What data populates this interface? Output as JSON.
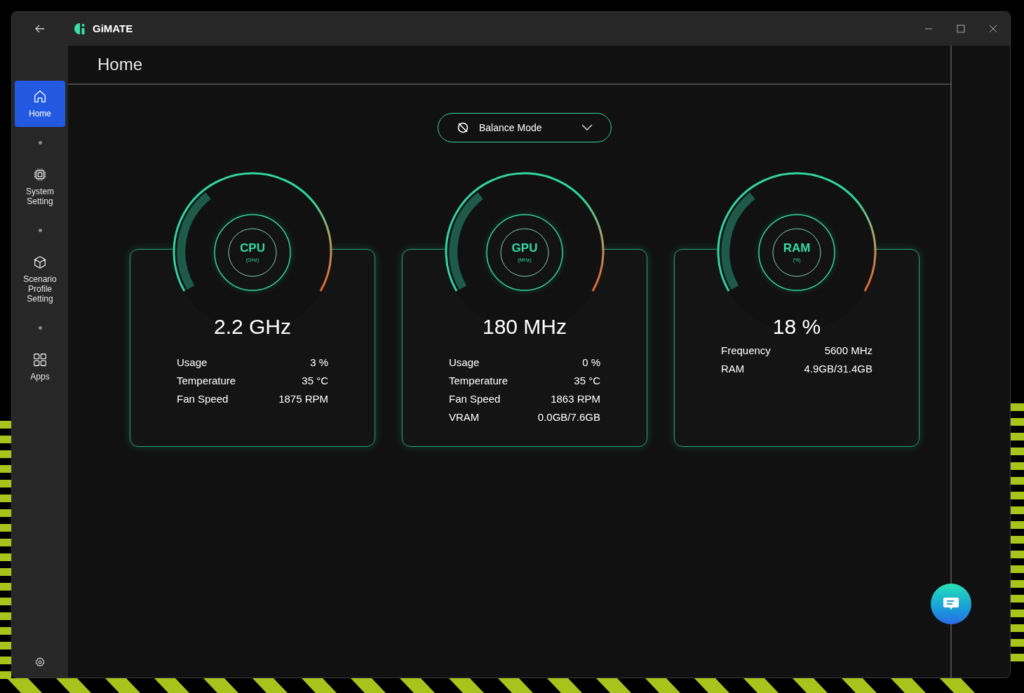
{
  "window": {
    "app_name": "GiMATE"
  },
  "sidebar": {
    "items": [
      {
        "kind": "home",
        "label": "Home",
        "selected": true
      },
      {
        "kind": "chip",
        "label": "System Setting",
        "selected": false
      },
      {
        "kind": "cube",
        "label": "Scenario Profile Setting",
        "selected": false
      },
      {
        "kind": "grid",
        "label": "Apps",
        "selected": false
      }
    ]
  },
  "page_title": "Home",
  "mode_dropdown": {
    "value": "Balance Mode"
  },
  "monitors": [
    {
      "name": "CPU",
      "unit": "(GHz)",
      "value": "2.2 GHz",
      "rows": [
        {
          "label": "Usage",
          "value": "3 %"
        },
        {
          "label": "Temperature",
          "value": "35 °C"
        },
        {
          "label": "Fan Speed",
          "value": "1875 RPM"
        }
      ]
    },
    {
      "name": "GPU",
      "unit": "(MHz)",
      "value": "180 MHz",
      "rows": [
        {
          "label": "Usage",
          "value": "0 %"
        },
        {
          "label": "Temperature",
          "value": "35 °C"
        },
        {
          "label": "Fan Speed",
          "value": "1863 RPM"
        },
        {
          "label": "VRAM",
          "value": "0.0GB/7.6GB"
        }
      ]
    },
    {
      "name": "RAM",
      "unit": "(%)",
      "value": "18 %",
      "rows": [
        {
          "label": "Frequency",
          "value": "5600 MHz"
        },
        {
          "label": "RAM",
          "value": "4.9GB/31.4GB"
        }
      ]
    }
  ]
}
